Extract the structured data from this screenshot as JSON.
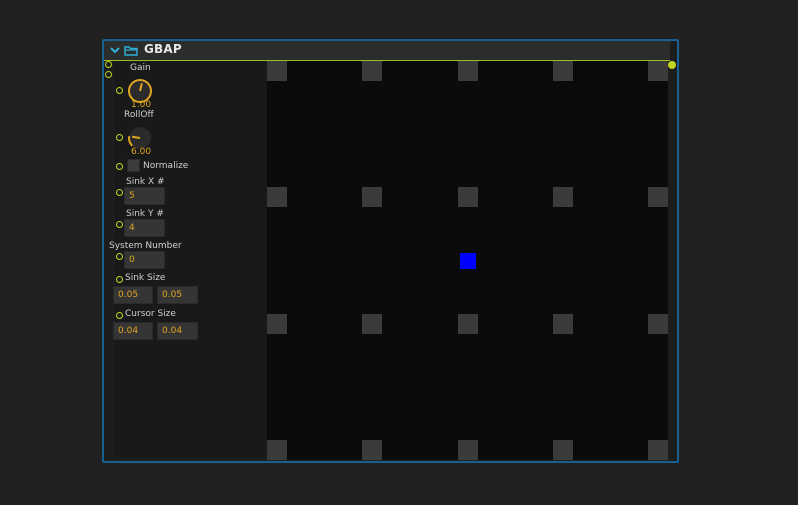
{
  "node": {
    "title": "GBAP",
    "icons": {
      "collapse": "chevron-down-icon",
      "folder": "folder-icon"
    }
  },
  "params": {
    "gain": {
      "label": "Gain",
      "value": "1.00",
      "knob_fraction": 0.55
    },
    "rolloff": {
      "label": "RollOff",
      "value": "6.00",
      "knob_fraction": 0.2
    },
    "normalize": {
      "label": "Normalize",
      "checked": false
    },
    "sink_x": {
      "label": "Sink X #",
      "value": "5"
    },
    "sink_y": {
      "label": "Sink Y #",
      "value": "4"
    },
    "system_number": {
      "label": "System Number",
      "value": "0"
    },
    "sink_size": {
      "label": "Sink Size",
      "x": "0.05",
      "y": "0.05"
    },
    "cursor_size": {
      "label": "Cursor Size",
      "x": "0.04",
      "y": "0.04"
    }
  },
  "grid": {
    "columns": 5,
    "rows": 4,
    "cursor_x": 0.5,
    "cursor_y": 0.5,
    "colors": {
      "background": "#0b0b0b",
      "sink": "#3b3b3b",
      "cursor": "#0000ff",
      "accent": "#c3d61f",
      "value": "#e0a622"
    }
  }
}
